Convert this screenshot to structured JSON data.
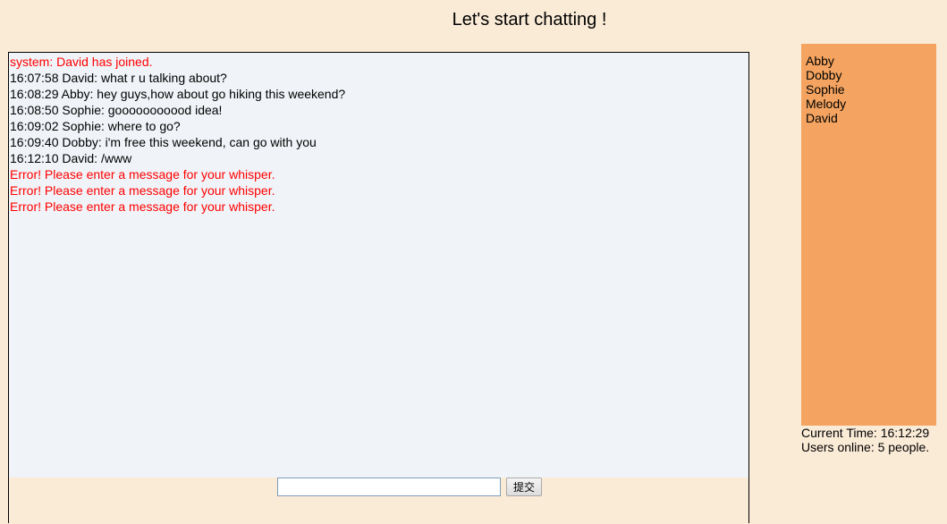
{
  "header": {
    "title": "Let's start chatting !"
  },
  "chat": {
    "messages": [
      {
        "text": "system: David has joined.",
        "kind": "system"
      },
      {
        "text": "16:07:58 David: what r u talking about?",
        "kind": "normal"
      },
      {
        "text": "16:08:29 Abby: hey guys,how about go hiking this weekend?",
        "kind": "normal"
      },
      {
        "text": "16:08:50 Sophie: gooooooooood idea!",
        "kind": "normal"
      },
      {
        "text": "16:09:02 Sophie: where to go?",
        "kind": "normal"
      },
      {
        "text": "16:09:40 Dobby: i'm free this weekend, can go with you",
        "kind": "normal"
      },
      {
        "text": "16:12:10 David: /www",
        "kind": "normal"
      },
      {
        "text": "Error! Please enter a message for your whisper.",
        "kind": "error"
      },
      {
        "text": "Error! Please enter a message for your whisper.",
        "kind": "error"
      },
      {
        "text": "Error! Please enter a message for your whisper.",
        "kind": "error"
      }
    ],
    "input": {
      "value": "",
      "placeholder": ""
    },
    "submit_label": "提交"
  },
  "users": {
    "list": [
      "Abby",
      "Dobby",
      "Sophie",
      "Melody",
      "David"
    ]
  },
  "status": {
    "current_time": "Current Time: 16:12:29",
    "users_online": "Users online: 5 people."
  },
  "colors": {
    "page_background": "#FAEBD7",
    "chat_background": "#F0F4F8",
    "user_list_background": "#F4A460",
    "system_text": "#FF0000",
    "error_text": "#FF0000"
  }
}
